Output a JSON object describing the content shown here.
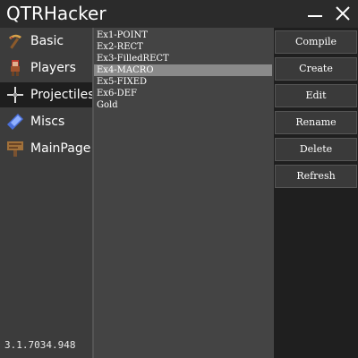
{
  "window": {
    "title": "QTRHacker",
    "version": "3.1.7034.948"
  },
  "titlebar": {
    "minimize_icon": "minimize-icon",
    "close_icon": "close-icon"
  },
  "sidebar": {
    "items": [
      {
        "label": "Basic",
        "icon": "pickaxe-icon"
      },
      {
        "label": "Players",
        "icon": "player-icon"
      },
      {
        "label": "Projectiles",
        "icon": "crosshair-icon"
      },
      {
        "label": "Miscs",
        "icon": "crystal-icon"
      },
      {
        "label": "MainPage",
        "icon": "signpost-icon"
      }
    ],
    "active_index": 2
  },
  "list": {
    "items": [
      "Ex1-POINT",
      "Ex2-RECT",
      "Ex3-FilledRECT",
      "Ex4-MACRO",
      "Ex5-FIXED",
      "Ex6-DEF",
      "Gold"
    ],
    "selected_index": 3
  },
  "actions": {
    "compile": "Compile",
    "create": "Create",
    "edit": "Edit",
    "rename": "Rename",
    "delete": "Delete",
    "refresh": "Refresh"
  },
  "colors": {
    "background": "#2b2b2b",
    "sidebar": "#3c3c3c",
    "sidebar_active": "#1e1e1e",
    "list_background": "#444444",
    "list_selected": "#8a8a8a",
    "button_background": "#3a3a3a",
    "text": "#ffffff"
  }
}
